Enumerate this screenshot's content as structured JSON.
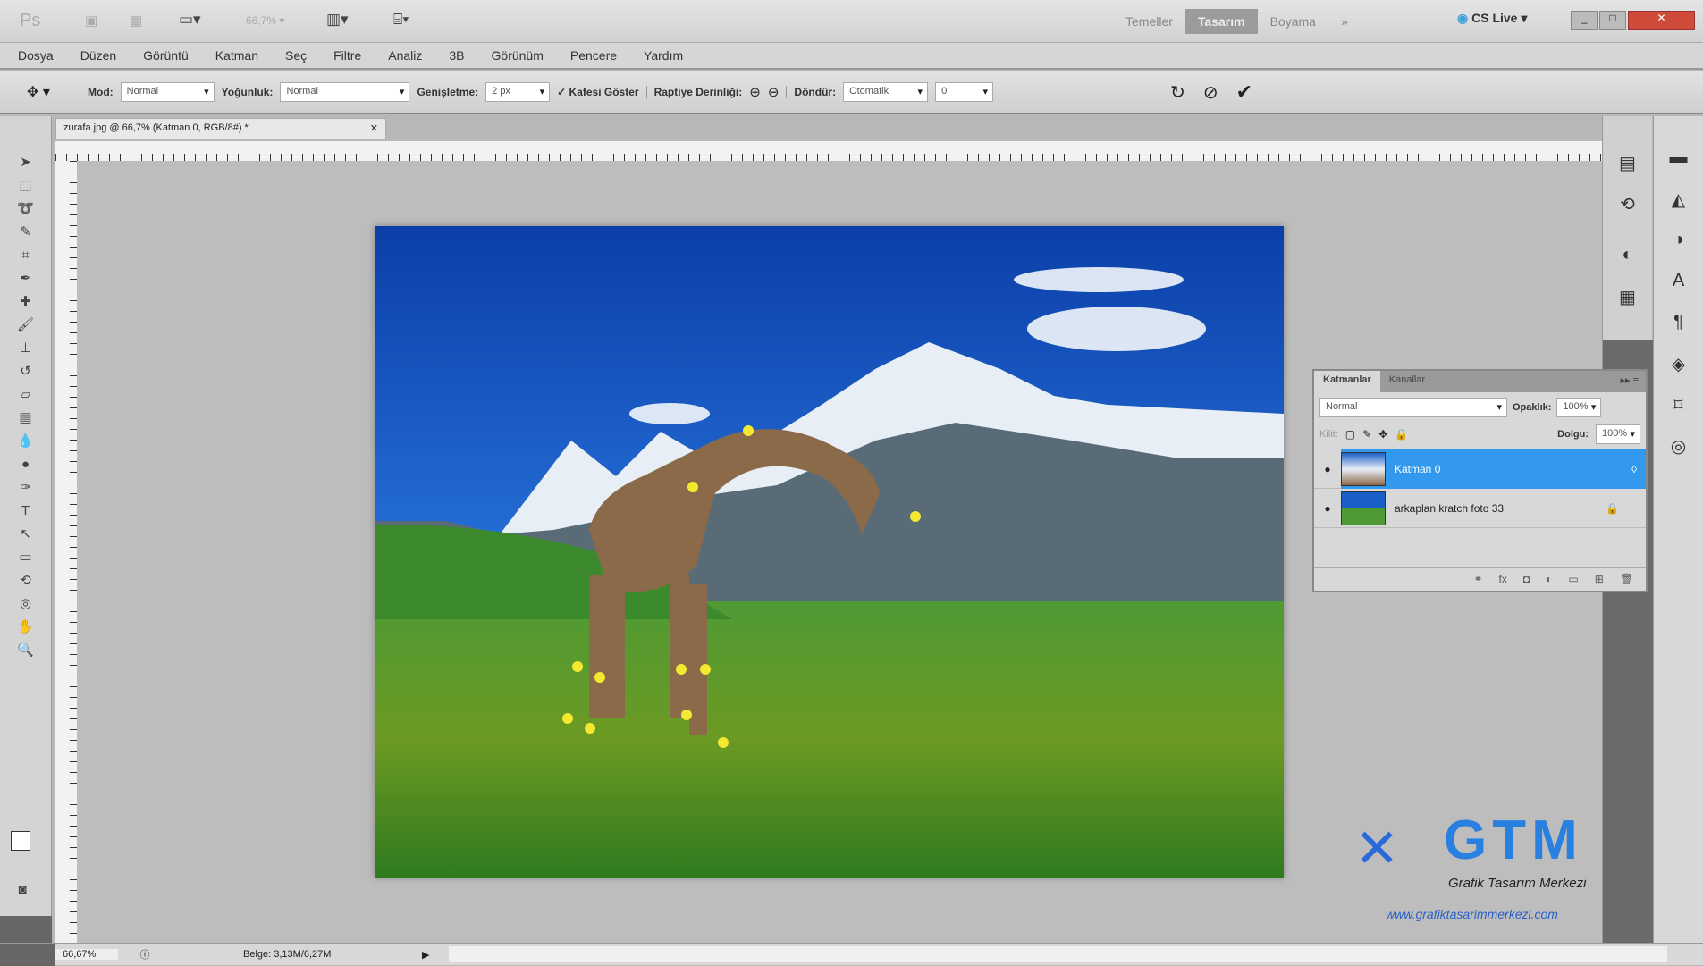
{
  "titlebar": {
    "app_logo": "Ps",
    "zoom": "66,7",
    "cs_live": "CS Live",
    "workspaces": [
      "Temeller",
      "Tasarım",
      "Boyama"
    ],
    "active_workspace": 1,
    "more": "»"
  },
  "menu": [
    "Dosya",
    "Düzen",
    "Görüntü",
    "Katman",
    "Seç",
    "Filtre",
    "Analiz",
    "3B",
    "Görünüm",
    "Pencere",
    "Yardım"
  ],
  "options": {
    "mode_label": "Mod:",
    "mode_value": "Normal",
    "density_label": "Yoğunluk:",
    "density_value": "Normal",
    "expand_label": "Genişletme:",
    "expand_value": "2 px",
    "show_mesh": "Kafesi Göster",
    "pin_depth_label": "Raptiye Derinliği:",
    "rotate_label": "Döndür:",
    "rotate_value": "Otomatik",
    "angle_value": "0"
  },
  "document": {
    "tab_title": "zurafa.jpg @ 66,7% (Katman 0, RGB/8#) *"
  },
  "layers_panel": {
    "tabs": [
      "Katmanlar",
      "Kanallar"
    ],
    "blend_mode": "Normal",
    "opacity_label": "Opaklık:",
    "opacity": "100%",
    "lock_label": "Kilit:",
    "fill_label": "Dolgu:",
    "fill": "100%",
    "layers": [
      {
        "name": "Katman 0",
        "selected": true
      },
      {
        "name": "arkaplan kratch foto 33",
        "selected": false
      }
    ]
  },
  "status": {
    "zoom": "66,67%",
    "doc_size": "Belge: 3,13M/6,27M"
  },
  "watermark": {
    "logo": "GTM",
    "tagline": "Grafik Tasarım Merkezi",
    "url": "www.grafiktasarimmerkezi.com"
  },
  "colors": {
    "accent": "#3399ee",
    "sky": "#1a5fc8",
    "grass": "#3f8f2a"
  }
}
